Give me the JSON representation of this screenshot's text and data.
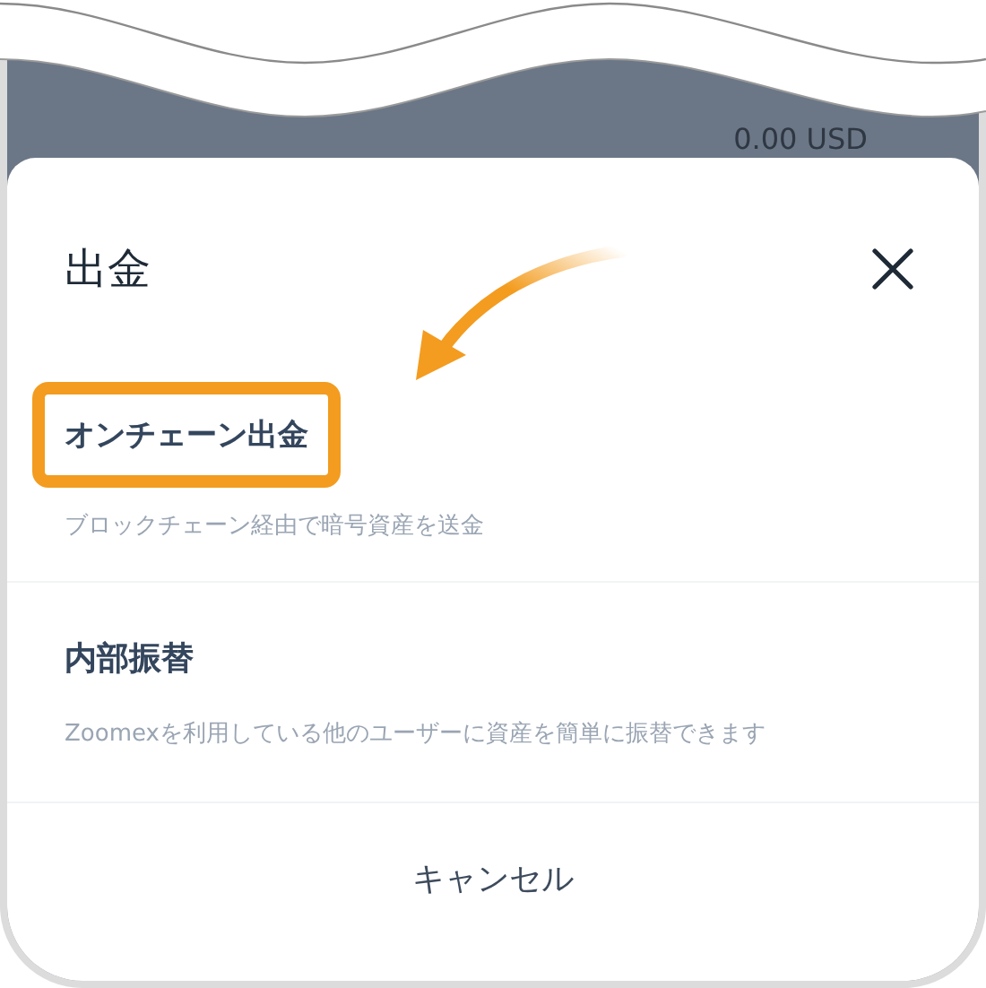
{
  "background": {
    "balance": "0.00 USD"
  },
  "sheet": {
    "title": "出金"
  },
  "options": [
    {
      "title": "オンチェーン出金",
      "description": "ブロックチェーン経由で暗号資産を送金",
      "highlighted": true
    },
    {
      "title": "内部振替",
      "description": "Zoomexを利用している他のユーザーに資産を簡単に振替できます",
      "highlighted": false
    }
  ],
  "cancel": "キャンセル"
}
